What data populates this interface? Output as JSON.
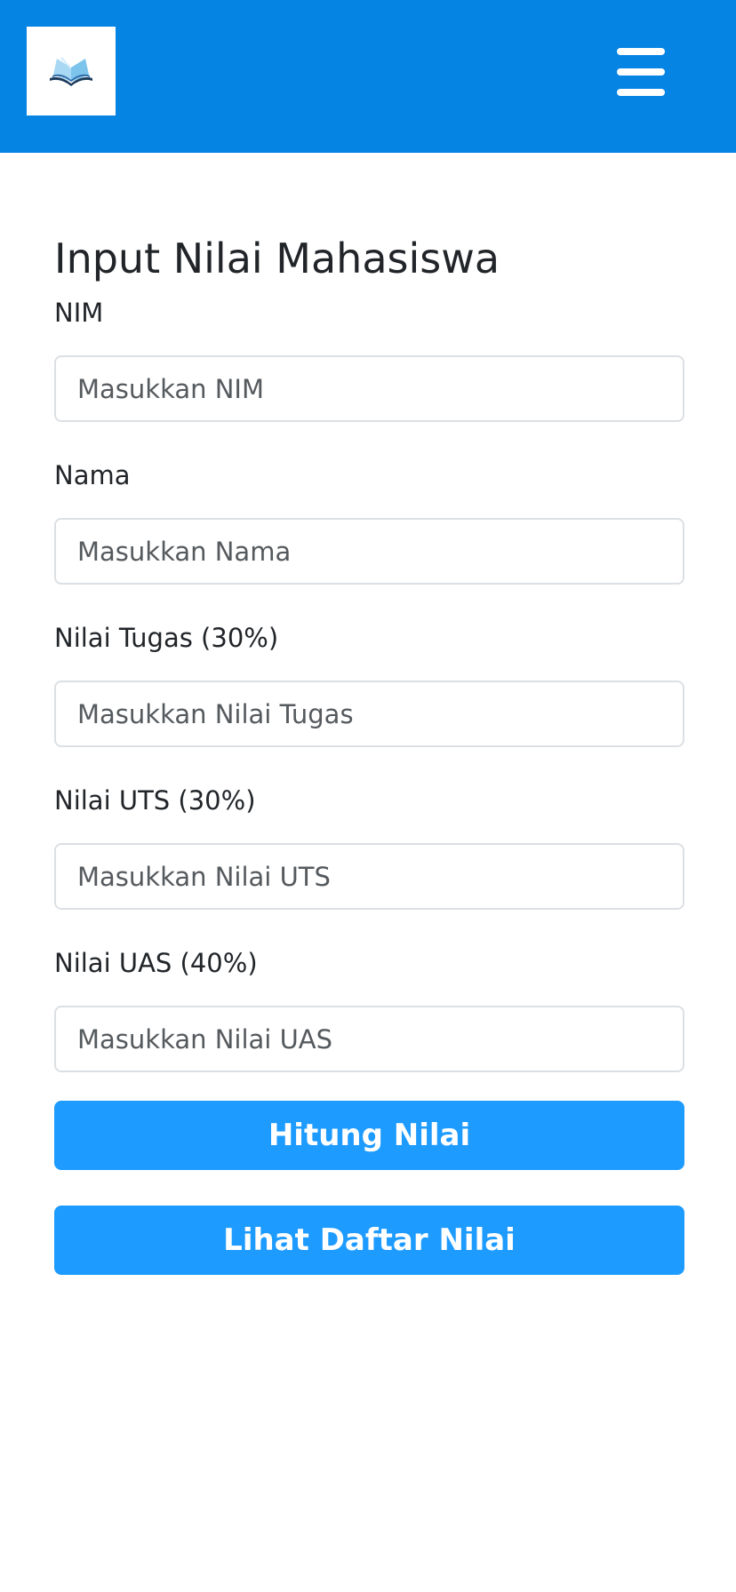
{
  "navbar": {
    "logo_icon": "open-book-icon",
    "menu_icon": "hamburger-menu-icon",
    "background_color": "#0584e4"
  },
  "form": {
    "title": "Input Nilai Mahasiswa",
    "fields": [
      {
        "label": "NIM",
        "placeholder": "Masukkan NIM",
        "value": ""
      },
      {
        "label": "Nama",
        "placeholder": "Masukkan Nama",
        "value": ""
      },
      {
        "label": "Nilai Tugas (30%)",
        "placeholder": "Masukkan Nilai Tugas",
        "value": ""
      },
      {
        "label": "Nilai UTS (30%)",
        "placeholder": "Masukkan Nilai UTS",
        "value": ""
      },
      {
        "label": "Nilai UAS (40%)",
        "placeholder": "Masukkan Nilai UAS",
        "value": ""
      }
    ],
    "calculate_button_label": "Hitung Nilai",
    "view_list_button_label": "Lihat Daftar Nilai",
    "button_color": "#1e9bff"
  }
}
